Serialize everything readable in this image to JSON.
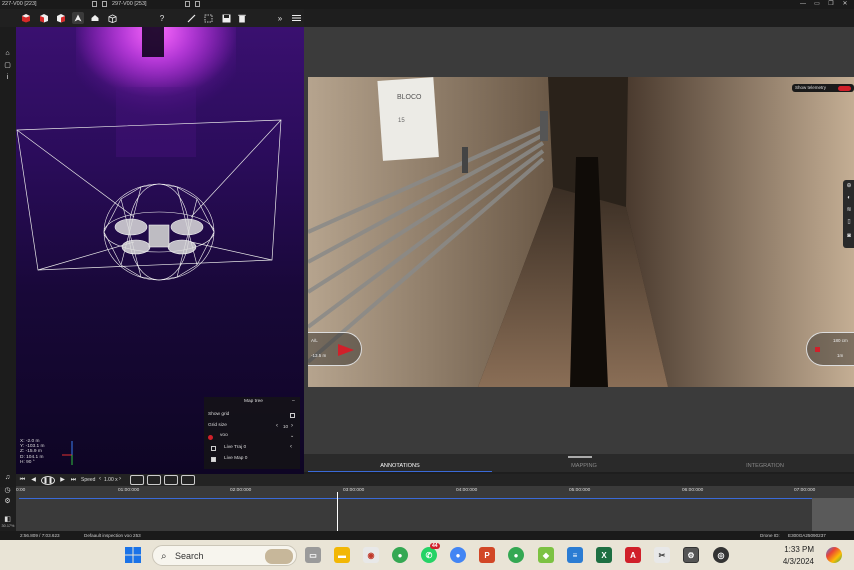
{
  "window": {
    "tabs": [
      {
        "label": "227-V00 [223]"
      },
      {
        "label": "297-V00 [253]"
      }
    ],
    "controls": {
      "minimize": "—",
      "maximize": "▭",
      "restore": "❐",
      "close": "✕"
    }
  },
  "toolbar": {
    "help": "?"
  },
  "viewport": {
    "coords": {
      "x": "X:   -2.0 m",
      "y": "Y: -103.1 m",
      "z": "Z:   -15.9 m",
      "d": "D: 104.1 m",
      "h": "H:    90 °"
    }
  },
  "map_tree": {
    "title": "Map tree",
    "show_grid": "Show grid",
    "grid_size_label": "Grid size",
    "grid_size_value": "10",
    "dataset": "voo",
    "live_traj": "Live Traj 0",
    "live_map": "Live Map 0"
  },
  "video": {
    "show_telemetry": "Show telemetry",
    "sign_text": "BLOCO",
    "sign_sub": "15",
    "left_gauge": {
      "top": "A/L",
      "bottom": "-13.5 m"
    },
    "right_gauge": {
      "top": "180 cm",
      "bottom": "1m"
    }
  },
  "bottom_tabs": [
    {
      "label": "ANNOTATIONS",
      "active": true
    },
    {
      "label": "MAPPING",
      "active": false
    },
    {
      "label": "INTEGRATION",
      "active": false
    }
  ],
  "playbar": {
    "speed_label": "Speed",
    "speed_value": "1.00 x"
  },
  "timeline": {
    "ticks": [
      "0:00",
      "01:00:000",
      "02:00:000",
      "03:00:000",
      "04:00:000",
      "05:00:000",
      "06:00:000",
      "07:00:000"
    ],
    "cursor_position": 0.4
  },
  "status": {
    "time": "2:56.809 / 7:03.623",
    "mission": "Defaault inspection  voo  253",
    "drone": "Drone ID:",
    "drone_id": "E300GA25090237",
    "side_time": "30.17%"
  },
  "taskbar": {
    "search_placeholder": "Search",
    "clock_time": "1:33 PM",
    "clock_date": "4/3/2024",
    "badges": {
      "whatsapp": "44"
    },
    "colors": {
      "start": "#1a73e8",
      "bg": "#e9e4d6"
    }
  },
  "colors": {
    "accent_red": "#d0202a",
    "timeline_line": "#3a6ad8",
    "purple_glow": "#e040f0"
  }
}
